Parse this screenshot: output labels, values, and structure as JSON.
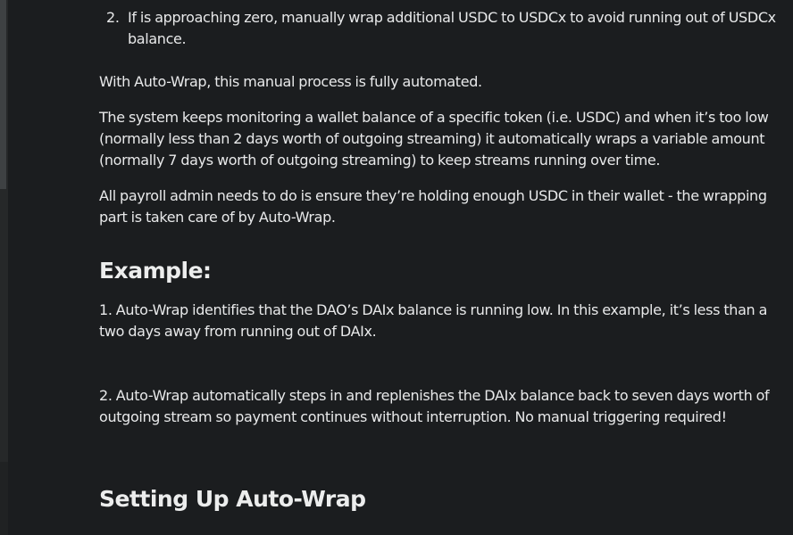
{
  "list_item": {
    "number": "2.",
    "line1": "If is approaching zero, manually wrap additional USDC to USDCx to avoid running out of USDCx",
    "line2": "balance."
  },
  "paragraphs": {
    "auto_wrap_intro": "With Auto-Wrap, this manual process is fully automated.",
    "system_line1": "The system keeps monitoring a wallet balance of a specific token (i.e. USDC) and when it’s too low",
    "system_line2": "(normally less than 2 days worth of outgoing streaming) it automatically wraps a variable amount",
    "system_line3": "(normally 7 days worth of outgoing streaming) to keep streams running over time.",
    "admin_line1": "All payroll admin needs to do is ensure they’re holding enough USDC in their wallet - the wrapping",
    "admin_line2": "part is taken care of by Auto-Wrap."
  },
  "example": {
    "heading": "Example:",
    "step1_line1": "1.  Auto-Wrap identifies that the DAO’s DAIx balance is running low. In this example, it’s less than a",
    "step1_line2": "two days away from running out of DAIx.",
    "step2_line1": "2.  Auto-Wrap automatically steps in and replenishes the DAIx balance back to seven days worth of",
    "step2_line2": "outgoing stream so payment continues without interruption. No manual triggering required!"
  },
  "setup": {
    "heading": "Setting Up Auto-Wrap"
  }
}
